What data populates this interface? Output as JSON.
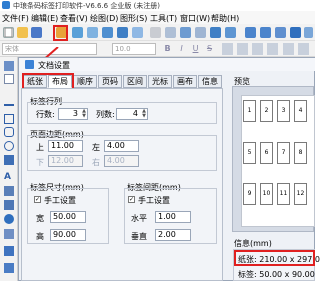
{
  "app": {
    "title": "中琅条码标签打印软件-V6.6.6 企业版 (未注册)",
    "icon": "app-logo-icon"
  },
  "menu": [
    "文件(F)",
    "编辑(E)",
    "查看(V)",
    "绘图(D)",
    "图形(S)",
    "工具(T)",
    "窗口(W)",
    "帮助(H)"
  ],
  "toolbar2": {
    "font_name": "宋体",
    "font_size": "10.0",
    "bold": "B",
    "italic": "I",
    "underline": "U",
    "strike": "S"
  },
  "dialog": {
    "title": "文档设置",
    "tabs": [
      "纸张",
      "布局",
      "顺序",
      "页码",
      "区间",
      "光标",
      "画布",
      "信息"
    ],
    "active_tab": 1,
    "rows_cols": {
      "legend": "标签行列",
      "rows_label": "行数:",
      "rows_value": "3",
      "cols_label": "列数:",
      "cols_value": "4"
    },
    "margins": {
      "legend": "页面边距(mm)",
      "top_label": "上",
      "top_value": "11.00",
      "left_label": "左",
      "left_value": "4.00",
      "bottom_label": "下",
      "bottom_value": "12.00",
      "right_label": "右",
      "right_value": "4.00"
    },
    "label_size": {
      "legend": "标签尺寸(mm)",
      "manual_label": "手工设置",
      "manual_checked": true,
      "width_label": "宽",
      "width_value": "50.00",
      "height_label": "高",
      "height_value": "90.00"
    },
    "label_gap": {
      "legend": "标签间距(mm)",
      "manual_label": "手工设置",
      "manual_checked": true,
      "h_label": "水平",
      "h_value": "1.00",
      "v_label": "垂直",
      "v_value": "2.00"
    },
    "preview": {
      "label": "预览",
      "cells": [
        "1",
        "2",
        "3",
        "4",
        "5",
        "6",
        "7",
        "8",
        "9",
        "10",
        "11",
        "12"
      ]
    },
    "info": {
      "label": "信息(mm)",
      "paper": "纸张: 210.00 x 297.00",
      "label_size": "标签: 50.00 x 90.00"
    }
  }
}
